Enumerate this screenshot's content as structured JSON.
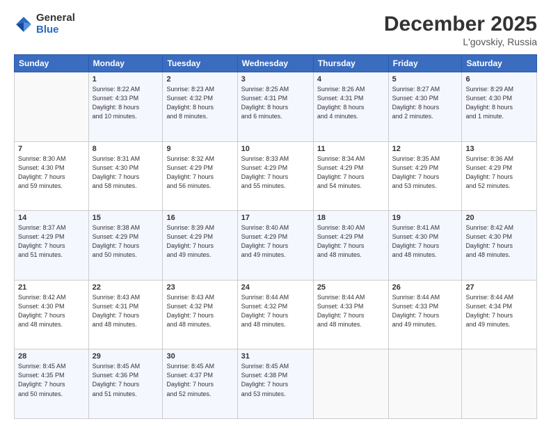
{
  "logo": {
    "general": "General",
    "blue": "Blue"
  },
  "header": {
    "month": "December 2025",
    "location": "L'govskiy, Russia"
  },
  "weekdays": [
    "Sunday",
    "Monday",
    "Tuesday",
    "Wednesday",
    "Thursday",
    "Friday",
    "Saturday"
  ],
  "weeks": [
    [
      {
        "day": "",
        "info": ""
      },
      {
        "day": "1",
        "info": "Sunrise: 8:22 AM\nSunset: 4:33 PM\nDaylight: 8 hours\nand 10 minutes."
      },
      {
        "day": "2",
        "info": "Sunrise: 8:23 AM\nSunset: 4:32 PM\nDaylight: 8 hours\nand 8 minutes."
      },
      {
        "day": "3",
        "info": "Sunrise: 8:25 AM\nSunset: 4:31 PM\nDaylight: 8 hours\nand 6 minutes."
      },
      {
        "day": "4",
        "info": "Sunrise: 8:26 AM\nSunset: 4:31 PM\nDaylight: 8 hours\nand 4 minutes."
      },
      {
        "day": "5",
        "info": "Sunrise: 8:27 AM\nSunset: 4:30 PM\nDaylight: 8 hours\nand 2 minutes."
      },
      {
        "day": "6",
        "info": "Sunrise: 8:29 AM\nSunset: 4:30 PM\nDaylight: 8 hours\nand 1 minute."
      }
    ],
    [
      {
        "day": "7",
        "info": "Sunrise: 8:30 AM\nSunset: 4:30 PM\nDaylight: 7 hours\nand 59 minutes."
      },
      {
        "day": "8",
        "info": "Sunrise: 8:31 AM\nSunset: 4:30 PM\nDaylight: 7 hours\nand 58 minutes."
      },
      {
        "day": "9",
        "info": "Sunrise: 8:32 AM\nSunset: 4:29 PM\nDaylight: 7 hours\nand 56 minutes."
      },
      {
        "day": "10",
        "info": "Sunrise: 8:33 AM\nSunset: 4:29 PM\nDaylight: 7 hours\nand 55 minutes."
      },
      {
        "day": "11",
        "info": "Sunrise: 8:34 AM\nSunset: 4:29 PM\nDaylight: 7 hours\nand 54 minutes."
      },
      {
        "day": "12",
        "info": "Sunrise: 8:35 AM\nSunset: 4:29 PM\nDaylight: 7 hours\nand 53 minutes."
      },
      {
        "day": "13",
        "info": "Sunrise: 8:36 AM\nSunset: 4:29 PM\nDaylight: 7 hours\nand 52 minutes."
      }
    ],
    [
      {
        "day": "14",
        "info": "Sunrise: 8:37 AM\nSunset: 4:29 PM\nDaylight: 7 hours\nand 51 minutes."
      },
      {
        "day": "15",
        "info": "Sunrise: 8:38 AM\nSunset: 4:29 PM\nDaylight: 7 hours\nand 50 minutes."
      },
      {
        "day": "16",
        "info": "Sunrise: 8:39 AM\nSunset: 4:29 PM\nDaylight: 7 hours\nand 49 minutes."
      },
      {
        "day": "17",
        "info": "Sunrise: 8:40 AM\nSunset: 4:29 PM\nDaylight: 7 hours\nand 49 minutes."
      },
      {
        "day": "18",
        "info": "Sunrise: 8:40 AM\nSunset: 4:29 PM\nDaylight: 7 hours\nand 48 minutes."
      },
      {
        "day": "19",
        "info": "Sunrise: 8:41 AM\nSunset: 4:30 PM\nDaylight: 7 hours\nand 48 minutes."
      },
      {
        "day": "20",
        "info": "Sunrise: 8:42 AM\nSunset: 4:30 PM\nDaylight: 7 hours\nand 48 minutes."
      }
    ],
    [
      {
        "day": "21",
        "info": "Sunrise: 8:42 AM\nSunset: 4:30 PM\nDaylight: 7 hours\nand 48 minutes."
      },
      {
        "day": "22",
        "info": "Sunrise: 8:43 AM\nSunset: 4:31 PM\nDaylight: 7 hours\nand 48 minutes."
      },
      {
        "day": "23",
        "info": "Sunrise: 8:43 AM\nSunset: 4:32 PM\nDaylight: 7 hours\nand 48 minutes."
      },
      {
        "day": "24",
        "info": "Sunrise: 8:44 AM\nSunset: 4:32 PM\nDaylight: 7 hours\nand 48 minutes."
      },
      {
        "day": "25",
        "info": "Sunrise: 8:44 AM\nSunset: 4:33 PM\nDaylight: 7 hours\nand 48 minutes."
      },
      {
        "day": "26",
        "info": "Sunrise: 8:44 AM\nSunset: 4:33 PM\nDaylight: 7 hours\nand 49 minutes."
      },
      {
        "day": "27",
        "info": "Sunrise: 8:44 AM\nSunset: 4:34 PM\nDaylight: 7 hours\nand 49 minutes."
      }
    ],
    [
      {
        "day": "28",
        "info": "Sunrise: 8:45 AM\nSunset: 4:35 PM\nDaylight: 7 hours\nand 50 minutes."
      },
      {
        "day": "29",
        "info": "Sunrise: 8:45 AM\nSunset: 4:36 PM\nDaylight: 7 hours\nand 51 minutes."
      },
      {
        "day": "30",
        "info": "Sunrise: 8:45 AM\nSunset: 4:37 PM\nDaylight: 7 hours\nand 52 minutes."
      },
      {
        "day": "31",
        "info": "Sunrise: 8:45 AM\nSunset: 4:38 PM\nDaylight: 7 hours\nand 53 minutes."
      },
      {
        "day": "",
        "info": ""
      },
      {
        "day": "",
        "info": ""
      },
      {
        "day": "",
        "info": ""
      }
    ]
  ]
}
